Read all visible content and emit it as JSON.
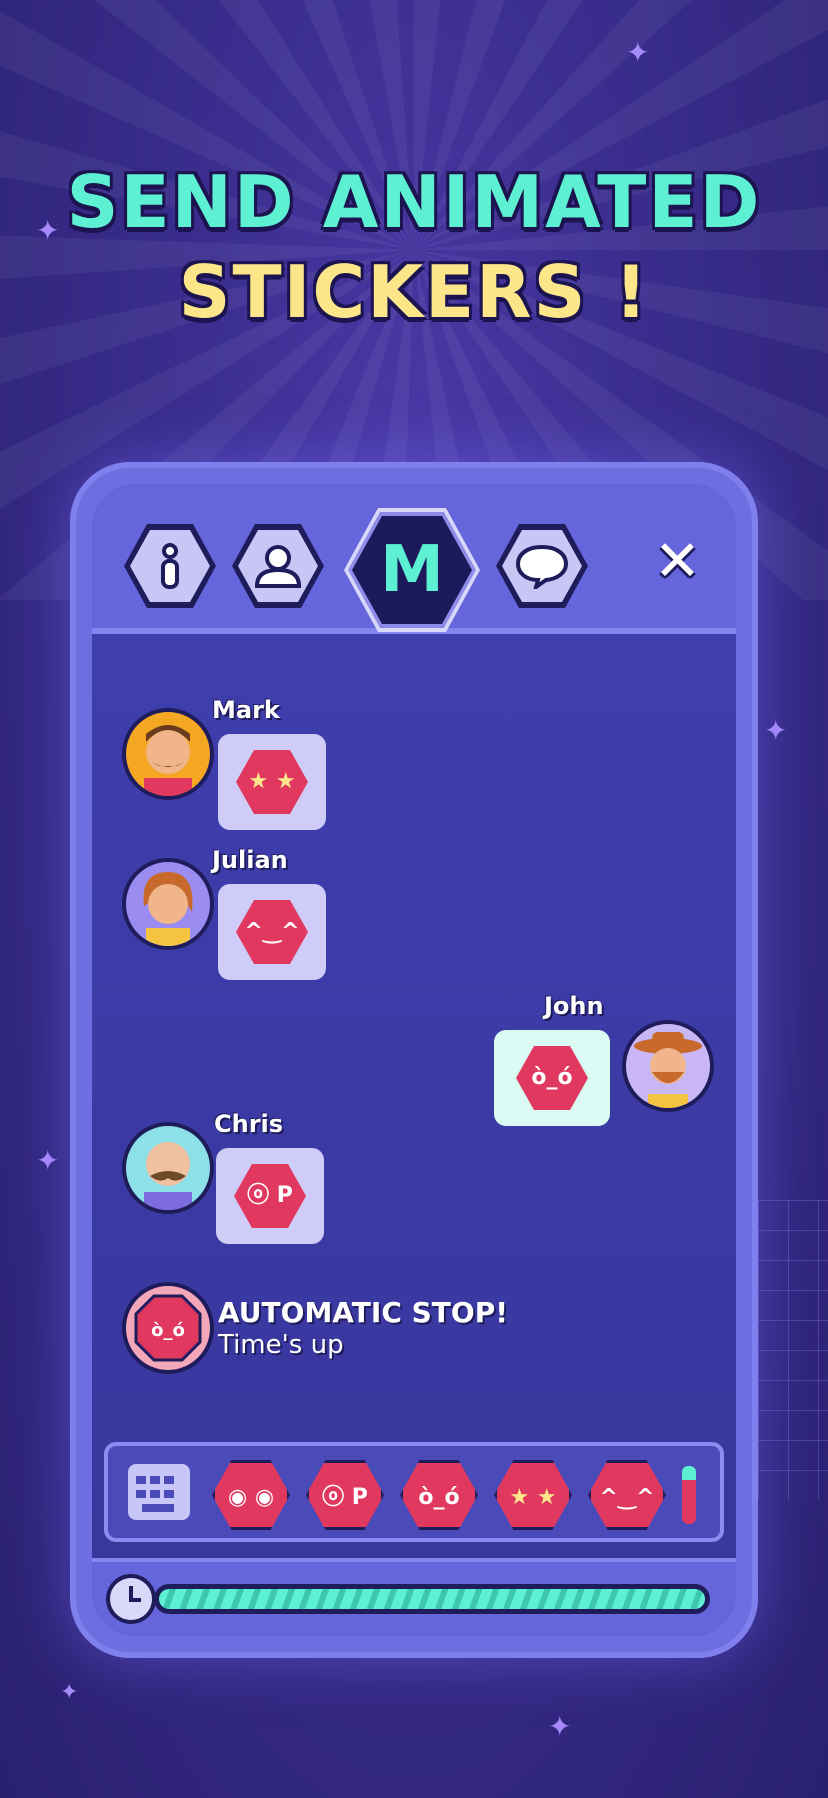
{
  "headline": {
    "line1": "SEND ANIMATED",
    "line2": "STICKERS !"
  },
  "tabs": [
    {
      "icon": "info-icon"
    },
    {
      "icon": "user-icon"
    },
    {
      "icon": "m-logo",
      "label": "M"
    },
    {
      "icon": "chat-icon"
    }
  ],
  "close_label": "✕",
  "messages": [
    {
      "sender": "Mark",
      "sticker": "star-eyes-sticker",
      "side": "left"
    },
    {
      "sender": "Julian",
      "sticker": "party-sticker",
      "side": "left"
    },
    {
      "sender": "John",
      "sticker": "angry-sticker",
      "side": "right"
    },
    {
      "sender": "Chris",
      "sticker": "silly-sticker",
      "side": "left"
    }
  ],
  "system_message": {
    "title": "AUTOMATIC STOP!",
    "subtitle": "Time's up"
  },
  "sticker_tray": [
    "surprised-sticker",
    "silly-sticker",
    "angry-sticker",
    "star-eyes-sticker",
    "party-sticker"
  ],
  "timer": {
    "progress": 1.0
  },
  "colors": {
    "accent": "#5ef0d2",
    "title_yellow": "#fde68a",
    "sticker": "#e0385e",
    "panel": "#6566db"
  }
}
